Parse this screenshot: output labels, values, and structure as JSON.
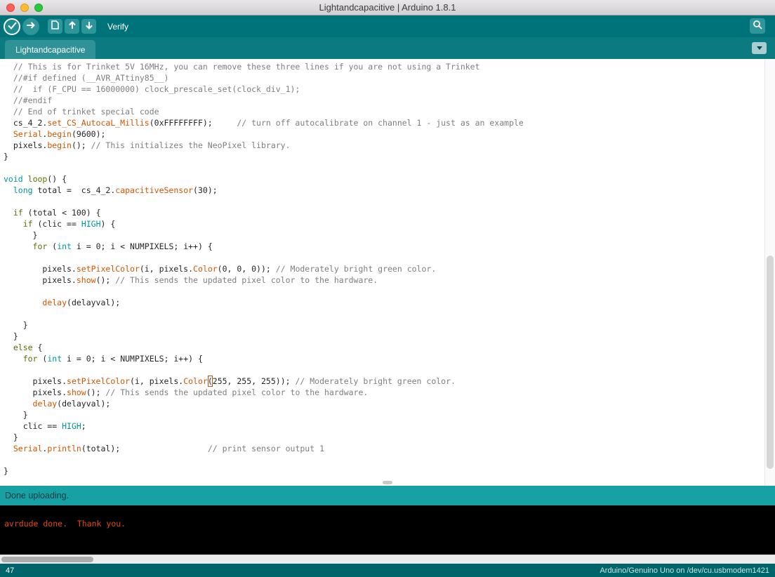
{
  "window": {
    "title": "Lightandcapacitive | Arduino 1.8.1"
  },
  "toolbar": {
    "hover_label": "Verify",
    "icons": [
      "check-icon",
      "arrow-right-icon",
      "document-icon",
      "arrow-up-icon",
      "arrow-down-icon",
      "magnifier-icon"
    ]
  },
  "tabs": {
    "active_label": "Lightandcapacitive",
    "menu_icon": "chevron-down-icon"
  },
  "editor": {
    "lines": [
      [
        [
          "p",
          "  "
        ],
        [
          "c",
          "// This is for Trinket 5V 16MHz, you can remove these three lines if you are not using a Trinket"
        ]
      ],
      [
        [
          "p",
          "  "
        ],
        [
          "c",
          "//#if defined (__AVR_ATtiny85__)"
        ]
      ],
      [
        [
          "p",
          "  "
        ],
        [
          "c",
          "//  if (F_CPU == 16000000) clock_prescale_set(clock_div_1);"
        ]
      ],
      [
        [
          "p",
          "  "
        ],
        [
          "c",
          "//#endif"
        ]
      ],
      [
        [
          "p",
          "  "
        ],
        [
          "c",
          "// End of trinket special code"
        ]
      ],
      [
        [
          "p",
          "  cs_4_2."
        ],
        [
          "f",
          "set_CS_AutocaL_Millis"
        ],
        [
          "p",
          "(0xFFFFFFFF);     "
        ],
        [
          "c",
          "// turn off autocalibrate on channel 1 - just as an example"
        ]
      ],
      [
        [
          "p",
          "  "
        ],
        [
          "f",
          "Serial"
        ],
        [
          "p",
          "."
        ],
        [
          "f",
          "begin"
        ],
        [
          "p",
          "(9600);"
        ]
      ],
      [
        [
          "p",
          "  pixels."
        ],
        [
          "f",
          "begin"
        ],
        [
          "p",
          "(); "
        ],
        [
          "c",
          "// This initializes the NeoPixel library."
        ]
      ],
      [
        [
          "p",
          "}"
        ]
      ],
      [],
      [
        [
          "t",
          "void"
        ],
        [
          "p",
          " "
        ],
        [
          "k",
          "loop"
        ],
        [
          "p",
          "() {"
        ]
      ],
      [
        [
          "p",
          "  "
        ],
        [
          "t",
          "long"
        ],
        [
          "p",
          " total =  cs_4_2."
        ],
        [
          "f",
          "capacitiveSensor"
        ],
        [
          "p",
          "(30);"
        ]
      ],
      [],
      [
        [
          "p",
          "  "
        ],
        [
          "k",
          "if"
        ],
        [
          "p",
          " (total < 100) {"
        ]
      ],
      [
        [
          "p",
          "    "
        ],
        [
          "k",
          "if"
        ],
        [
          "p",
          " (clic == "
        ],
        [
          "h",
          "HIGH"
        ],
        [
          "p",
          ") {"
        ]
      ],
      [
        [
          "p",
          "      }"
        ]
      ],
      [
        [
          "p",
          "      "
        ],
        [
          "k",
          "for"
        ],
        [
          "p",
          " ("
        ],
        [
          "t",
          "int"
        ],
        [
          "p",
          " i = 0; i < NUMPIXELS; i++) {"
        ]
      ],
      [],
      [
        [
          "p",
          "        pixels."
        ],
        [
          "f",
          "setPixelColor"
        ],
        [
          "p",
          "(i, pixels."
        ],
        [
          "f",
          "Color"
        ],
        [
          "p",
          "(0, 0, 0)); "
        ],
        [
          "c",
          "// Moderately bright green color."
        ]
      ],
      [
        [
          "p",
          "        pixels."
        ],
        [
          "f",
          "show"
        ],
        [
          "p",
          "(); "
        ],
        [
          "c",
          "// This sends the updated pixel color to the hardware."
        ]
      ],
      [],
      [
        [
          "p",
          "        "
        ],
        [
          "f",
          "delay"
        ],
        [
          "p",
          "(delayval);"
        ]
      ],
      [],
      [
        [
          "p",
          "    }"
        ]
      ],
      [
        [
          "p",
          "  }"
        ]
      ],
      [
        [
          "p",
          "  "
        ],
        [
          "k",
          "else"
        ],
        [
          "p",
          " {"
        ]
      ],
      [
        [
          "p",
          "    "
        ],
        [
          "k",
          "for"
        ],
        [
          "p",
          " ("
        ],
        [
          "t",
          "int"
        ],
        [
          "p",
          " i = 0; i < NUMPIXELS; i++) {"
        ]
      ],
      [],
      [
        [
          "p",
          "      pixels."
        ],
        [
          "f",
          "setPixelColor"
        ],
        [
          "p",
          "(i, pixels."
        ],
        [
          "f",
          "Color"
        ],
        [
          "b",
          "("
        ],
        [
          "p",
          "255, 255, 255)); "
        ],
        [
          "c",
          "// Moderately bright green color."
        ]
      ],
      [
        [
          "p",
          "      pixels."
        ],
        [
          "f",
          "show"
        ],
        [
          "p",
          "(); "
        ],
        [
          "c",
          "// This sends the updated pixel color to the hardware."
        ]
      ],
      [
        [
          "p",
          "      "
        ],
        [
          "f",
          "delay"
        ],
        [
          "p",
          "(delayval);"
        ]
      ],
      [
        [
          "p",
          "    }"
        ]
      ],
      [
        [
          "p",
          "    clic == "
        ],
        [
          "h",
          "HIGH"
        ],
        [
          "p",
          ";"
        ]
      ],
      [
        [
          "p",
          "  }"
        ]
      ],
      [
        [
          "p",
          "  "
        ],
        [
          "f",
          "Serial"
        ],
        [
          "p",
          "."
        ],
        [
          "f",
          "println"
        ],
        [
          "p",
          "(total);                  "
        ],
        [
          "c",
          "// print sensor output 1"
        ]
      ],
      [],
      [
        [
          "p",
          "}"
        ]
      ]
    ]
  },
  "status_bar": {
    "message": "Done uploading."
  },
  "console": {
    "lines": [
      "avrdude done.  Thank you."
    ]
  },
  "footer": {
    "line_number": "47",
    "board_info": "Arduino/Genuino Uno on /dev/cu.usbmodem1421"
  },
  "colors": {
    "toolbar_teal": "#00727A",
    "tabstrip_teal": "#0B7B81",
    "active_tab_teal": "#2E9297",
    "status_notice_teal": "#17A1A5",
    "footer_teal": "#00646B",
    "console_background": "#000000",
    "console_message_orange": "#E34C00",
    "syntax_comment": "#7E7E7E",
    "syntax_function": "#D35400",
    "syntax_type": "#00979C",
    "syntax_control": "#5E6D03",
    "syntax_constant": "#00979C"
  }
}
